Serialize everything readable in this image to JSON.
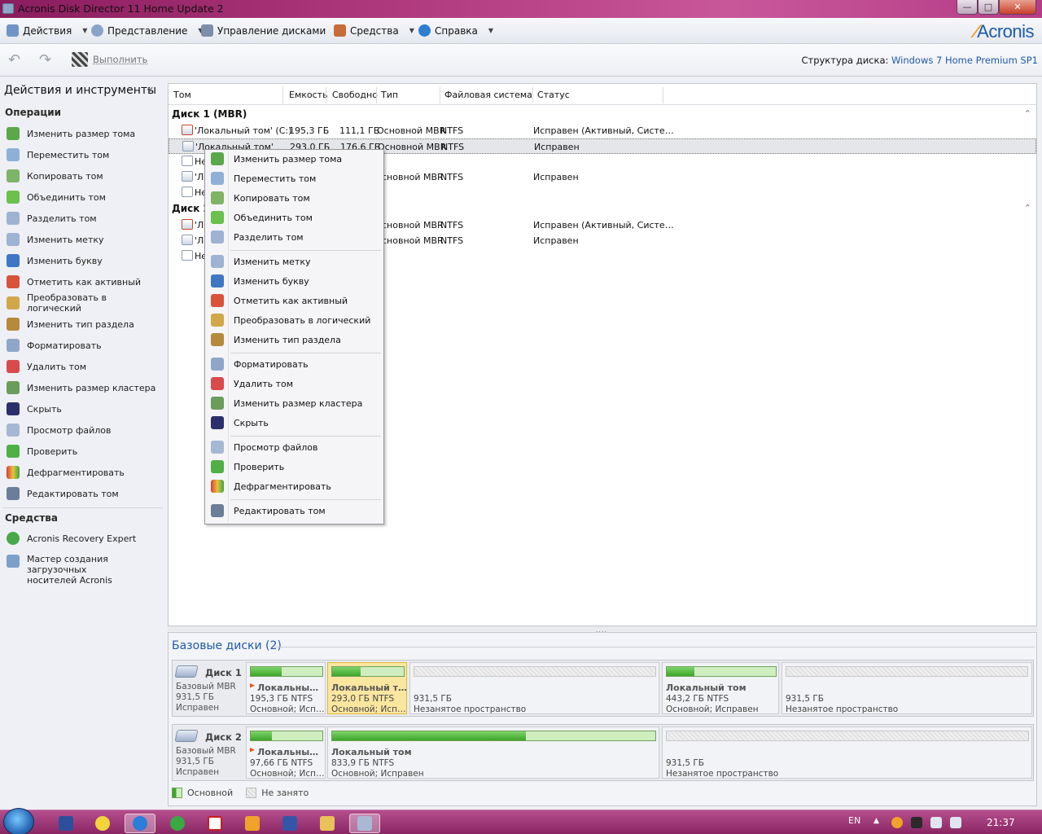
{
  "window": {
    "title": "Acronis Disk Director 11 Home Update 2",
    "min": "—",
    "max": "□",
    "close": "✕"
  },
  "menubar": {
    "items": [
      "Действия",
      "Представление",
      "Управление дисками",
      "Средства",
      "Справка"
    ],
    "logo": "Acronis"
  },
  "toolbar": {
    "undo": "↶",
    "redo": "↷",
    "execute": "Выполнить",
    "disk_structure_label": "Структура диска:",
    "disk_structure_value": "Windows 7 Home Premium SP1"
  },
  "sidebar": {
    "title": "Действия и инструменты",
    "collapse": "«",
    "operations_header": "Операции",
    "operations": [
      "Изменить размер тома",
      "Переместить том",
      "Копировать том",
      "Объединить том",
      "Разделить том",
      "Изменить метку",
      "Изменить букву",
      "Отметить как активный",
      "Преобразовать в логический",
      "Изменить тип раздела",
      "Форматировать",
      "Удалить том",
      "Изменить размер кластера",
      "Скрыть",
      "Просмотр файлов",
      "Проверить",
      "Дефрагментировать",
      "Редактировать том"
    ],
    "tools_header": "Средства",
    "tools": [
      "Acronis Recovery Expert",
      "Мастер создания загрузочных",
      "носителей Acronis"
    ]
  },
  "columns": [
    "Том",
    "Емкость",
    "Свободно",
    "Тип",
    "Файловая система",
    "Статус"
  ],
  "disk1": {
    "header": "Диск 1 (MBR)",
    "rows": [
      {
        "name": "'Локальный том' (C:)",
        "cap": "195,3 ГБ",
        "free": "111,1 ГБ",
        "type": "Основной MBR",
        "fs": "NTFS",
        "status": "Исправен (Активный, Систе…"
      },
      {
        "name": "'Локальный том'",
        "cap": "293,0 ГБ",
        "free": "176,6 ГБ",
        "type": "Основной MBR",
        "fs": "NTFS",
        "status": "Исправен"
      },
      {
        "name": "Не",
        "cap": "",
        "free": "",
        "type": "",
        "fs": "",
        "status": ""
      },
      {
        "name": "'Ло",
        "cap": "",
        "free": "",
        "type": "сновной MBR",
        "fs": "NTFS",
        "status": "Исправен"
      },
      {
        "name": "Не",
        "cap": "",
        "free": "",
        "type": "",
        "fs": "",
        "status": ""
      }
    ]
  },
  "disk2": {
    "header": "Диск 2",
    "rows": [
      {
        "name": "'Ло",
        "type": "сновной MBR",
        "fs": "NTFS",
        "status": "Исправен (Активный, Систе…"
      },
      {
        "name": "'Ло",
        "type": "сновной MBR",
        "fs": "NTFS",
        "status": "Исправен"
      },
      {
        "name": "Не",
        "type": "",
        "fs": "",
        "status": ""
      }
    ]
  },
  "chevron": "⌃",
  "context_menu": [
    "Изменить размер тома",
    "Переместить том",
    "Копировать том",
    "Объединить том",
    "Разделить том",
    "Изменить метку",
    "Изменить букву",
    "Отметить как активный",
    "Преобразовать в логический",
    "Изменить тип раздела",
    "Форматировать",
    "Удалить том",
    "Изменить размер кластера",
    "Скрыть",
    "Просмотр файлов",
    "Проверить",
    "Дефрагментировать",
    "Редактировать том"
  ],
  "splitter": "....",
  "basic_disks": {
    "title": "Базовые диски (2)",
    "disk1": {
      "name": "Диск 1",
      "type": "Базовый MBR",
      "size": "931,5 ГБ",
      "status": "Исправен",
      "parts": [
        {
          "name": "Локальны…",
          "size": "195,3 ГБ NTFS",
          "desc": "Основной; Исп…",
          "used": 0.43
        },
        {
          "name": "Локальный т…",
          "size": "293,0 ГБ NTFS",
          "desc": "Основной; Исп…",
          "used": 0.4
        },
        {
          "name": "",
          "size": "931,5 ГБ",
          "desc": "Незанятое пространство",
          "used": 0
        },
        {
          "name": "Локальный том",
          "size": "443,2 ГБ NTFS",
          "desc": "Основной; Исправен",
          "used": 0.25
        },
        {
          "name": "",
          "size": "931,5 ГБ",
          "desc": "Незанятое пространство",
          "used": 0
        }
      ]
    },
    "disk2": {
      "name": "Диск 2",
      "type": "Базовый MBR",
      "size": "931,5 ГБ",
      "status": "Исправен",
      "parts": [
        {
          "name": "Локальны…",
          "size": "97,66 ГБ NTFS",
          "desc": "Основной; Исп…",
          "used": 0.3
        },
        {
          "name": "Локальный том",
          "size": "833,9 ГБ NTFS",
          "desc": "Основной; Исправен",
          "used": 0.6
        },
        {
          "name": "",
          "size": "931,5 ГБ",
          "desc": "Незанятое пространство",
          "used": 0
        }
      ]
    },
    "legend": {
      "primary": "Основной",
      "unallocated": "Не занято"
    }
  },
  "taskbar": {
    "lang": "EN",
    "tray_arrow": "▲",
    "clock": "21:37"
  }
}
